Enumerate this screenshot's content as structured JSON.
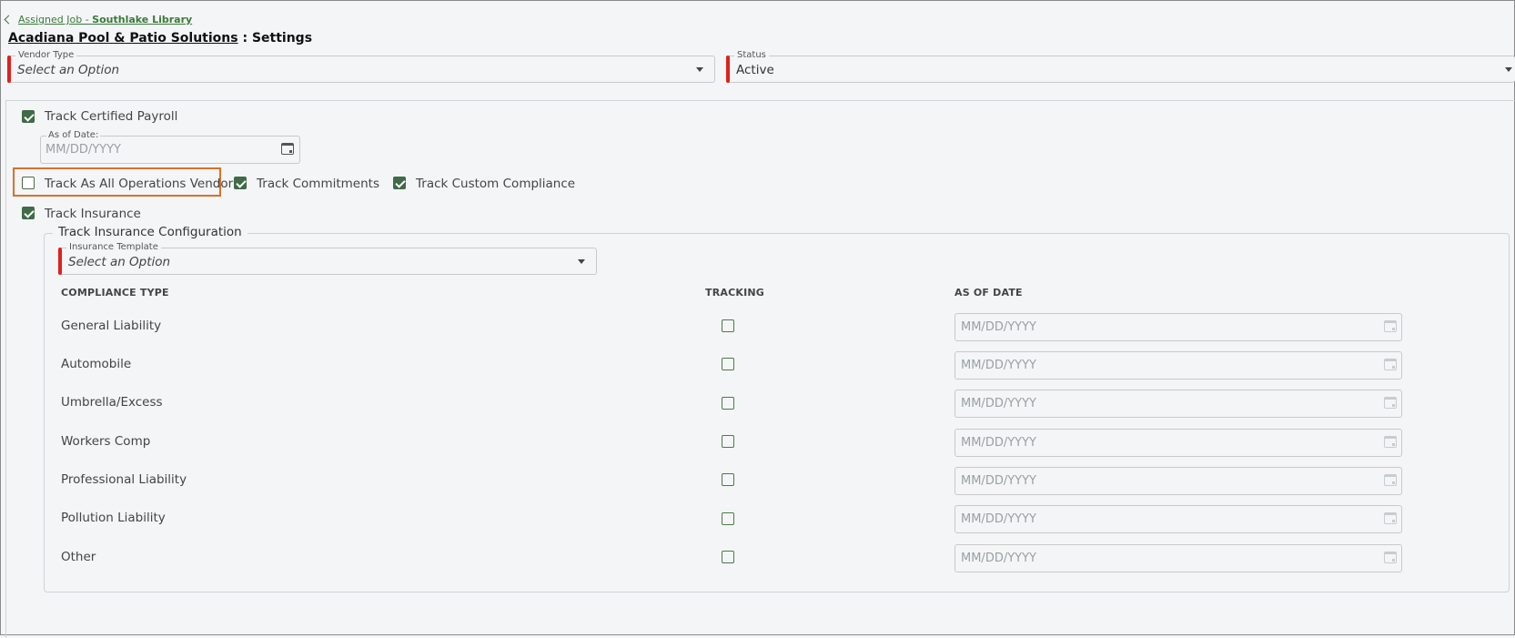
{
  "breadcrumb": {
    "prefix": "Assigned Job - ",
    "job": "Southlake Library"
  },
  "header": {
    "vendor": "Acadiana Pool & Patio Solutions",
    "separator": ":",
    "section": "Settings"
  },
  "vendor_type": {
    "label": "Vendor Type",
    "value": "Select an Option"
  },
  "status": {
    "label": "Status",
    "value": "Active"
  },
  "track_certified_payroll": {
    "label": "Track Certified Payroll",
    "checked": true
  },
  "as_of_date": {
    "label": "As of Date:",
    "placeholder": "MM/DD/YYYY"
  },
  "track_all_operations": {
    "label": "Track As All Operations Vendor",
    "checked": false
  },
  "track_commitments": {
    "label": "Track Commitments",
    "checked": true
  },
  "track_custom_compliance": {
    "label": "Track Custom Compliance",
    "checked": true
  },
  "track_insurance": {
    "label": "Track Insurance",
    "checked": true
  },
  "insurance_config": {
    "title": "Track Insurance Configuration",
    "template_label": "Insurance Template",
    "template_value": "Select an Option",
    "columns": [
      "COMPLIANCE TYPE",
      "TRACKING",
      "AS OF DATE"
    ],
    "rows": [
      {
        "type": "General Liability",
        "tracking": false,
        "date_placeholder": "MM/DD/YYYY"
      },
      {
        "type": "Automobile",
        "tracking": false,
        "date_placeholder": "MM/DD/YYYY"
      },
      {
        "type": "Umbrella/Excess",
        "tracking": false,
        "date_placeholder": "MM/DD/YYYY"
      },
      {
        "type": "Workers Comp",
        "tracking": false,
        "date_placeholder": "MM/DD/YYYY"
      },
      {
        "type": "Professional Liability",
        "tracking": false,
        "date_placeholder": "MM/DD/YYYY"
      },
      {
        "type": "Pollution Liability",
        "tracking": false,
        "date_placeholder": "MM/DD/YYYY"
      },
      {
        "type": "Other",
        "tracking": false,
        "date_placeholder": "MM/DD/YYYY"
      }
    ]
  },
  "colors": {
    "accent_green": "#3f6b46",
    "required_red": "#e0201b",
    "highlight_orange": "#d9702a"
  }
}
